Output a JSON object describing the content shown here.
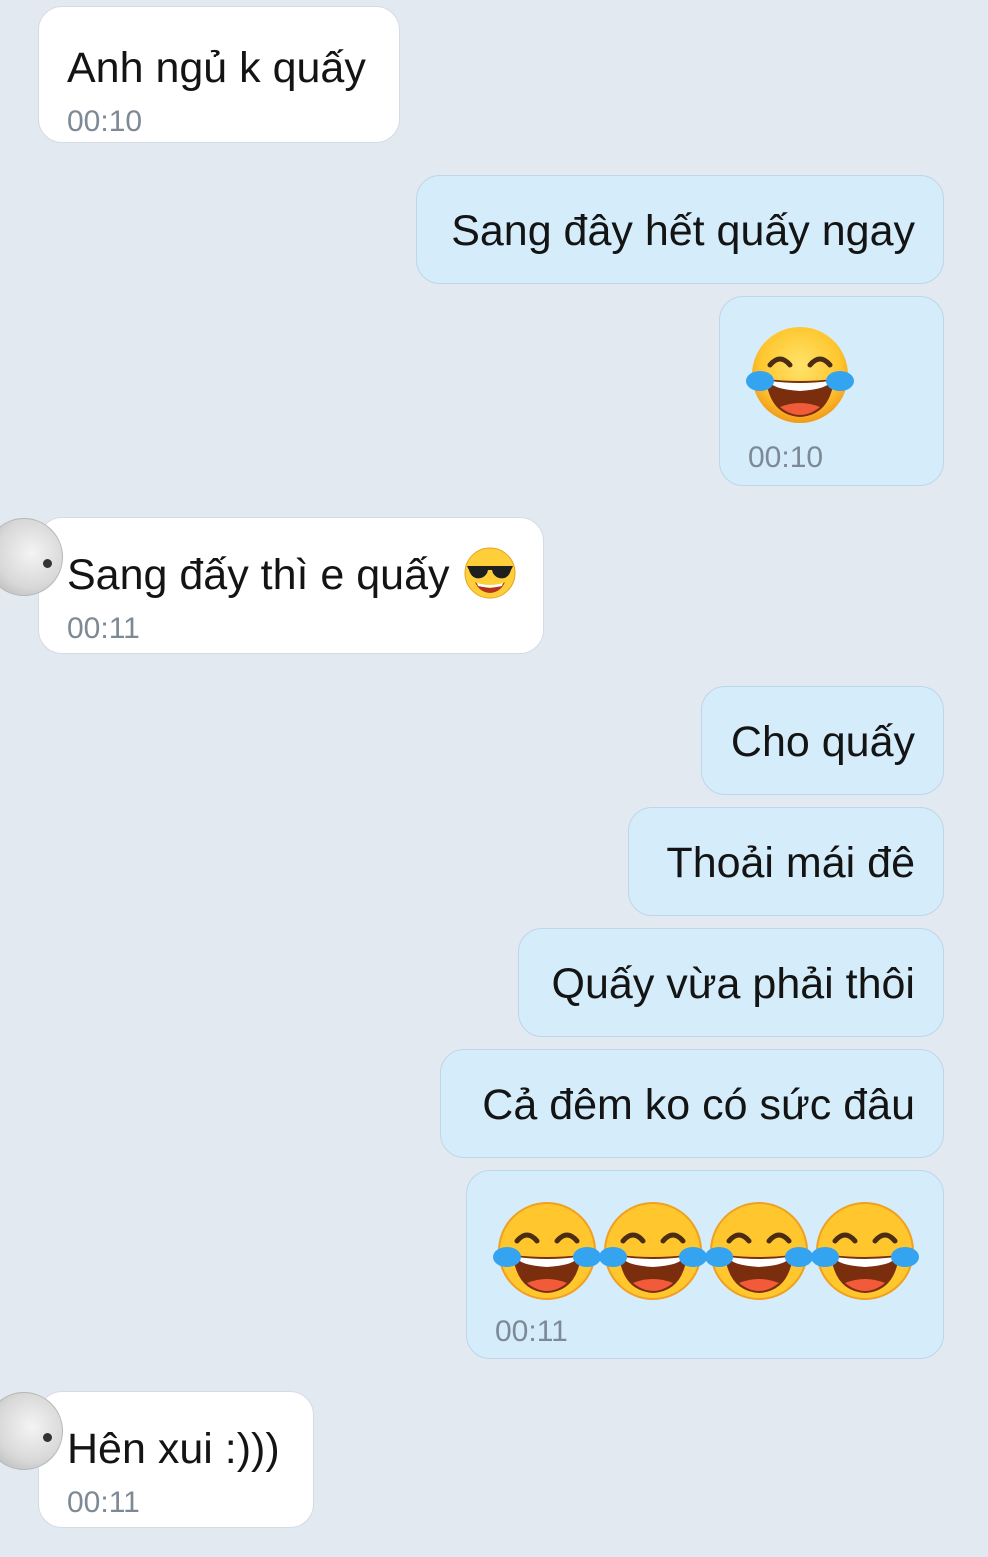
{
  "messages": [
    {
      "direction": "received",
      "text": "Anh ngủ k quấy",
      "time": "00:10"
    },
    {
      "direction": "sent",
      "text": "Sang đây hết quấy ngay"
    },
    {
      "direction": "sent",
      "emoji": "face-with-tears-of-joy-icon",
      "emoji_count": 1,
      "time": "00:10"
    },
    {
      "direction": "received",
      "text": "Sang đấy thì e quấy",
      "emoji": "smiling-face-with-sunglasses-icon",
      "time": "00:11"
    },
    {
      "direction": "sent",
      "text": "Cho quấy"
    },
    {
      "direction": "sent",
      "text": "Thoải mái đê"
    },
    {
      "direction": "sent",
      "text": "Quấy vừa phải thôi"
    },
    {
      "direction": "sent",
      "text": "Cả đêm ko có sức đâu"
    },
    {
      "direction": "sent",
      "emoji": "face-with-tears-of-joy-icon",
      "emoji_count": 4,
      "time": "00:11"
    },
    {
      "direction": "received",
      "text": "Hên xui :)))",
      "time": "00:11"
    }
  ],
  "colors": {
    "background": "#e2e9f1",
    "received_bubble": "#ffffff",
    "sent_bubble": "#d5edfb",
    "timestamp": "#7d8a96"
  }
}
